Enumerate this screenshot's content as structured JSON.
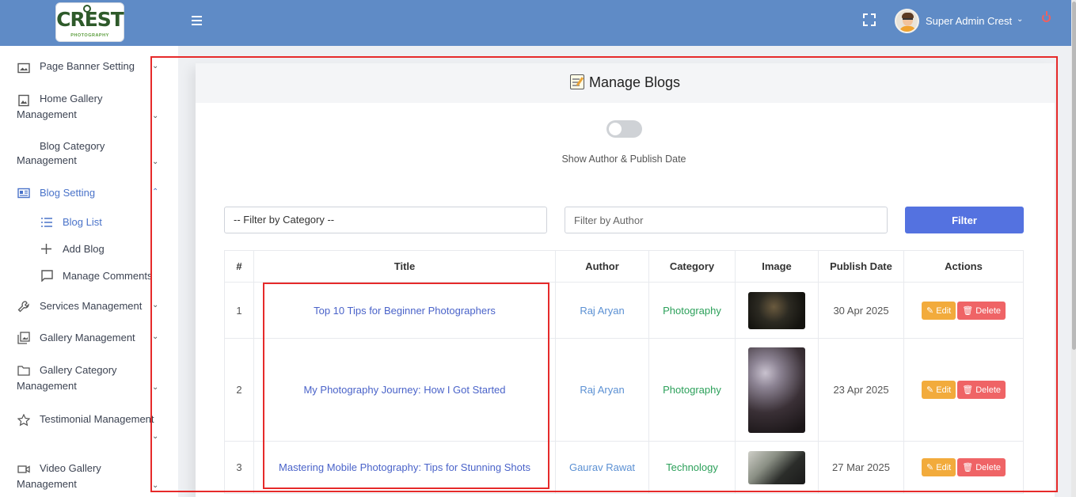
{
  "header": {
    "logo_text": "CREST",
    "logo_sub": "PHOTOGRAPHY",
    "user_name": "Super Admin Crest",
    "menu_icon": "hamburger-icon",
    "fullscreen_icon": "expand-icon",
    "power_icon": "power-icon"
  },
  "sidebar": {
    "items": [
      {
        "label": "Page Banner Setting",
        "icon": "image-icon"
      },
      {
        "label": "Home Gallery Management",
        "icon": "image-frame-icon"
      },
      {
        "label": "Blog Category Management",
        "icon": ""
      },
      {
        "label": "Blog Setting",
        "icon": "newspaper-icon"
      },
      {
        "label": "Services Management",
        "icon": "wrench-icon"
      },
      {
        "label": "Gallery Management",
        "icon": "gallery-icon"
      },
      {
        "label": "Gallery Category Management",
        "icon": "folder-icon"
      },
      {
        "label": "Testimonial Management",
        "icon": "star-icon"
      },
      {
        "label": "Video Gallery Management",
        "icon": "video-icon"
      }
    ],
    "home_gallery_line1": "Home Gallery",
    "home_gallery_line2": "Management",
    "blog_cat_line1": "Blog Category",
    "blog_cat_line2": "Management",
    "gallery_cat_line1": "Gallery Category",
    "gallery_cat_line2": "Management",
    "video_line1": "Video Gallery",
    "video_line2": "Management",
    "sub_items": [
      {
        "label": "Blog List",
        "icon": "list-icon"
      },
      {
        "label": "Add Blog",
        "icon": "plus-icon"
      },
      {
        "label": "Manage Comments",
        "icon": "comment-icon"
      }
    ]
  },
  "main": {
    "title": "Manage Blogs",
    "toggle_label": "Show Author & Publish Date",
    "category_filter": "-- Filter by Category --",
    "author_placeholder": "Filter by Author",
    "filter_button": "Filter",
    "columns": [
      "#",
      "Title",
      "Author",
      "Category",
      "Image",
      "Publish Date",
      "Actions"
    ],
    "rows": [
      {
        "num": "1",
        "title": "Top 10 Tips for Beginner Photographers",
        "author": "Raj Aryan",
        "category": "Photography",
        "date": "30 Apr 2025"
      },
      {
        "num": "2",
        "title": "My Photography Journey: How I Got Started",
        "author": "Raj Aryan",
        "category": "Photography",
        "date": "23 Apr 2025"
      },
      {
        "num": "3",
        "title": "Mastering Mobile Photography: Tips for Stunning Shots",
        "author": "Gaurav Rawat",
        "category": "Technology",
        "date": "27 Mar 2025"
      }
    ],
    "edit_label": "Edit",
    "delete_label": "Delete"
  },
  "colors": {
    "topbar": "#5f8bc6",
    "accent": "#5472e0",
    "edit": "#f2ab3c",
    "delete": "#ef6466",
    "category": "#2ca05a",
    "highlight": "#e62a2a"
  }
}
